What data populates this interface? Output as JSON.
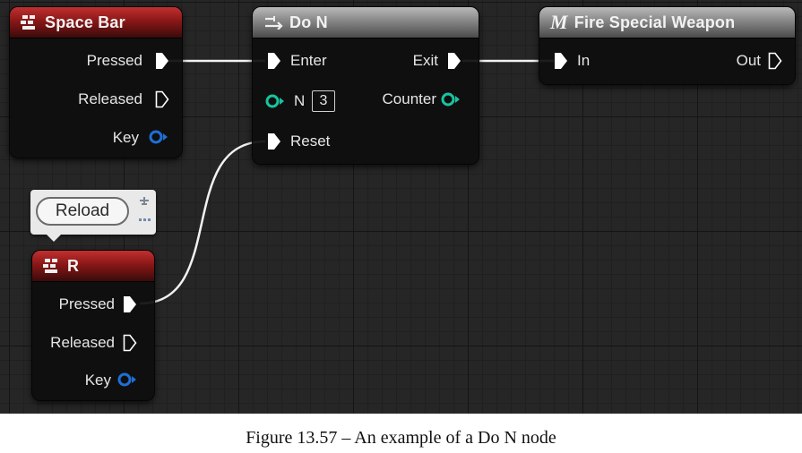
{
  "nodes": {
    "space_bar": {
      "title": "Space Bar",
      "pins": {
        "pressed": "Pressed",
        "released": "Released",
        "key": "Key"
      }
    },
    "do_n": {
      "title": "Do N",
      "pins": {
        "enter": "Enter",
        "exit": "Exit",
        "n": "N",
        "n_value": "3",
        "counter": "Counter",
        "reset": "Reset"
      }
    },
    "fire": {
      "title_prefix": "M",
      "title": "Fire Special Weapon",
      "pins": {
        "in": "In",
        "out": "Out"
      }
    },
    "r": {
      "title": "R",
      "pins": {
        "pressed": "Pressed",
        "released": "Released",
        "key": "Key"
      }
    }
  },
  "comment": {
    "label": "Reload"
  },
  "caption": "Figure 13.57 – An example of a Do N node",
  "colors": {
    "exec_pin": "#ffffff",
    "counter_pin": "#19c3a0",
    "key_pin": "#1e6fd6",
    "header_red": "#8a1717",
    "header_grey": "#8c8c8c"
  }
}
